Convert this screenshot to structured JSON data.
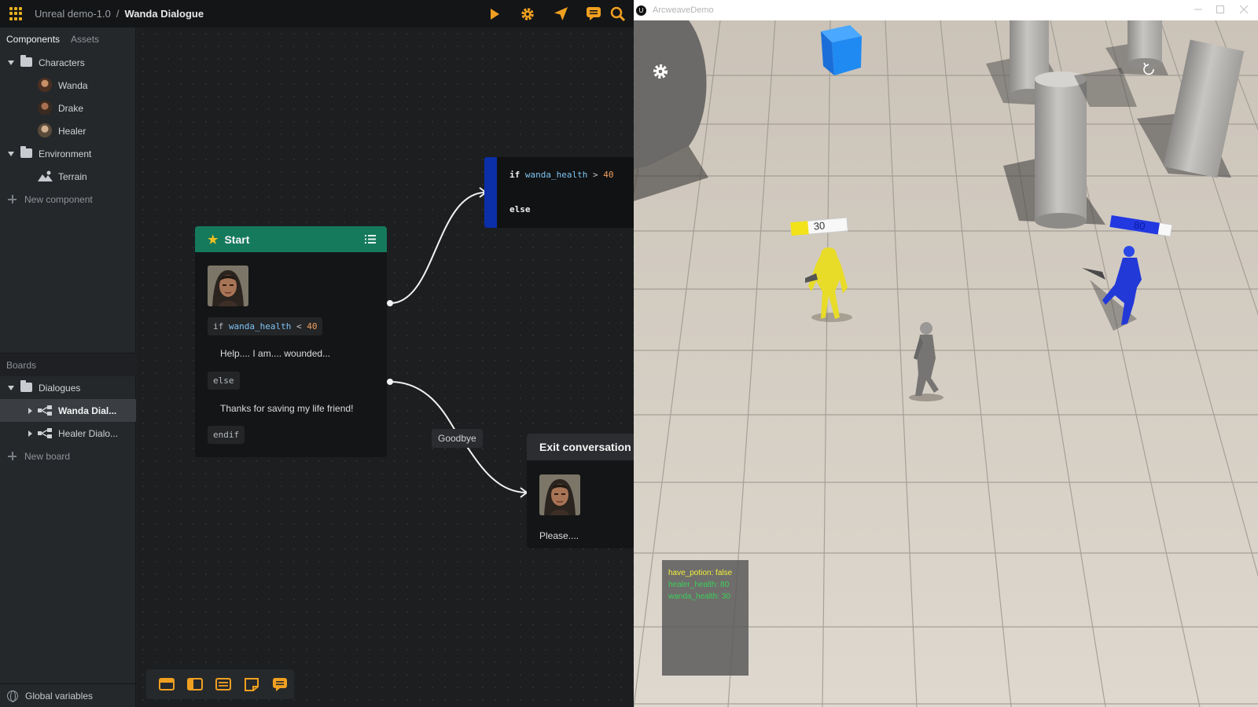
{
  "topbar": {
    "project": "Unreal demo-1.0",
    "separator": "/",
    "board": "Wanda Dialogue",
    "tools": [
      "play-icon",
      "gear-icon",
      "send-icon",
      "comment-icon",
      "search-icon"
    ]
  },
  "sidebar": {
    "tabs": [
      "Components",
      "Assets"
    ],
    "components": {
      "characters_folder": "Characters",
      "characters": [
        "Wanda",
        "Drake",
        "Healer"
      ],
      "environment_folder": "Environment",
      "environment": [
        "Terrain"
      ],
      "new_component": "New component"
    },
    "boards_title": "Boards",
    "boards": {
      "folder": "Dialogues",
      "items": [
        "Wanda Dial...",
        "Healer Dialo..."
      ],
      "new_board": "New board"
    },
    "global_variables": "Global variables"
  },
  "canvas": {
    "start_node": {
      "title": "Start",
      "if_kw": "if",
      "if_var": "wanda_health",
      "if_op": "<",
      "if_val": "40",
      "line1": "Help.... I am.... wounded...",
      "else_kw": "else",
      "line2": "Thanks for saving my life friend!",
      "endif_kw": "endif"
    },
    "cond_node": {
      "if_kw": "if",
      "var": "wanda_health",
      "op": ">",
      "val": "40",
      "else_kw": "else"
    },
    "goodbye_label": "Goodbye",
    "exit_node": {
      "title": "Exit conversation",
      "text": "Please...."
    }
  },
  "game": {
    "window_title": "ArcweaveDemo",
    "yellow_health": "30",
    "blue_health": "80",
    "hud": {
      "line1": "have_potion: false",
      "line2": "healer_health: 80",
      "line3": "wanda_health: 30"
    },
    "colors": {
      "hud_line1": "#f2ee3a",
      "hud_line2": "#3ccf5a",
      "hud_line3": "#3ccf5a"
    }
  }
}
